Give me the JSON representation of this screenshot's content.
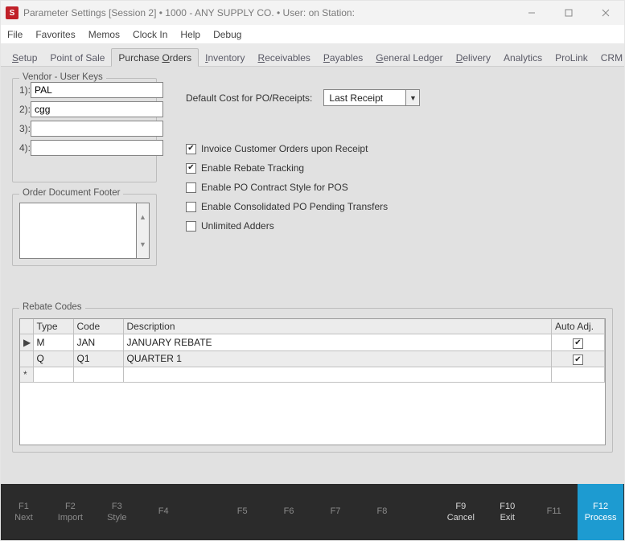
{
  "window": {
    "app_icon_letter": "S",
    "title": "Parameter Settings [Session 2]   •   1000 - ANY SUPPLY CO.   •   User:               on Station:"
  },
  "menu": {
    "items": [
      "File",
      "Favorites",
      "Memos",
      "Clock In",
      "Help",
      "Debug"
    ]
  },
  "tabs": [
    {
      "label": "Setup",
      "ul": "S",
      "active": false
    },
    {
      "label": "Point of Sale",
      "ul": "",
      "active": false
    },
    {
      "label": "Purchase Orders",
      "ul": "O",
      "active": true
    },
    {
      "label": "Inventory",
      "ul": "I",
      "active": false
    },
    {
      "label": "Receivables",
      "ul": "R",
      "active": false
    },
    {
      "label": "Payables",
      "ul": "P",
      "active": false
    },
    {
      "label": "General Ledger",
      "ul": "G",
      "active": false
    },
    {
      "label": "Delivery",
      "ul": "D",
      "active": false
    },
    {
      "label": "Analytics",
      "ul": "",
      "active": false
    },
    {
      "label": "ProLink",
      "ul": "",
      "active": false
    },
    {
      "label": "CRM",
      "ul": "",
      "active": false
    }
  ],
  "vendor_keys": {
    "legend": "Vendor - User Keys",
    "rows": [
      {
        "label": "1):",
        "value": "PAL"
      },
      {
        "label": "2):",
        "value": "cgg"
      },
      {
        "label": "3):",
        "value": ""
      },
      {
        "label": "4):",
        "value": ""
      }
    ]
  },
  "footer_group": {
    "legend": "Order Document Footer",
    "value": ""
  },
  "default_cost": {
    "label": "Default Cost for PO/Receipts:",
    "value": "Last Receipt"
  },
  "checkboxes": [
    {
      "label": "Invoice Customer Orders upon Receipt",
      "checked": true
    },
    {
      "label": "Enable Rebate Tracking",
      "checked": true
    },
    {
      "label": "Enable PO Contract Style for POS",
      "checked": false
    },
    {
      "label": "Enable Consolidated PO Pending Transfers",
      "checked": false
    },
    {
      "label": "Unlimited Adders",
      "checked": false
    }
  ],
  "rebate": {
    "legend": "Rebate Codes",
    "headers": {
      "type": "Type",
      "code": "Code",
      "desc": "Description",
      "auto": "Auto Adj."
    },
    "rows": [
      {
        "marker": "▶",
        "type": "M",
        "code": "JAN",
        "desc": "JANUARY REBATE",
        "auto": true
      },
      {
        "marker": "",
        "type": "Q",
        "code": "Q1",
        "desc": "QUARTER 1",
        "auto": true
      }
    ],
    "new_row_marker": "*"
  },
  "fnkeys": [
    {
      "key": "F1",
      "label": "Next",
      "style": "dim"
    },
    {
      "key": "F2",
      "label": "Import",
      "style": "dim"
    },
    {
      "key": "F3",
      "label": "Style",
      "style": "dim"
    },
    {
      "key": "F4",
      "label": "",
      "style": "dim"
    },
    {
      "key": "F5",
      "label": "",
      "style": "dim"
    },
    {
      "key": "F6",
      "label": "",
      "style": "dim"
    },
    {
      "key": "F7",
      "label": "",
      "style": "dim"
    },
    {
      "key": "F8",
      "label": "",
      "style": "dim"
    },
    {
      "key": "F9",
      "label": "Cancel",
      "style": "light"
    },
    {
      "key": "F10",
      "label": "Exit",
      "style": "light"
    },
    {
      "key": "F11",
      "label": "",
      "style": "dim"
    },
    {
      "key": "F12",
      "label": "Process",
      "style": "primary"
    }
  ]
}
